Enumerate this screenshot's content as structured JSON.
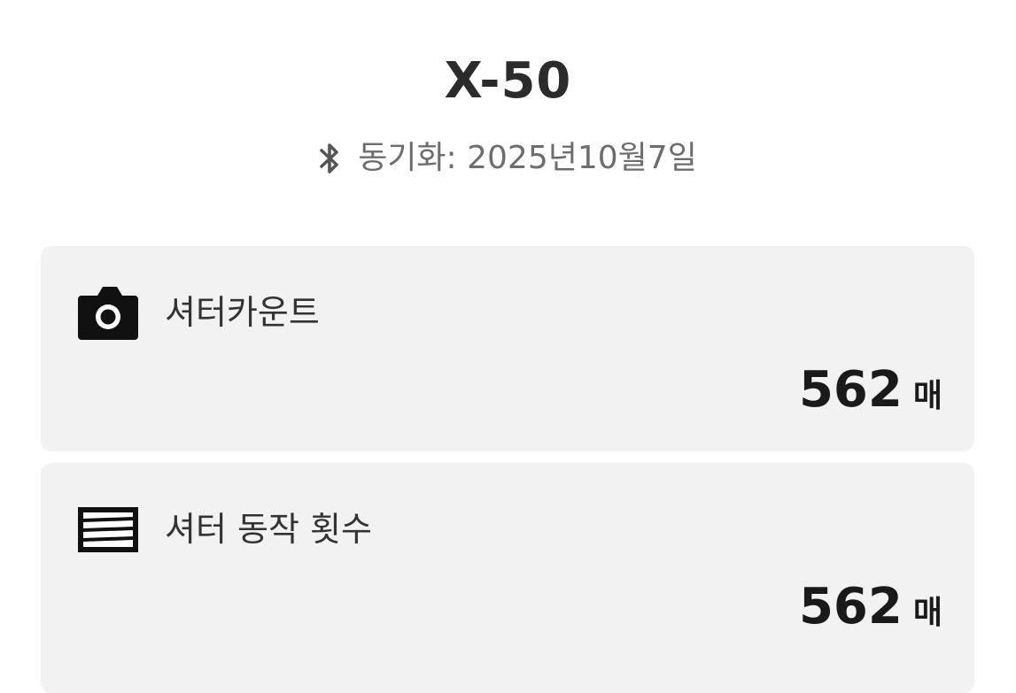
{
  "header": {
    "title": "X-50",
    "sync_icon": "bluetooth-icon",
    "sync_text": "동기화: 2025년10월7일"
  },
  "cards": [
    {
      "icon": "camera-icon",
      "label": "셔터카운트",
      "value": "562",
      "unit": "매"
    },
    {
      "icon": "shutter-icon",
      "label": "셔터 동작 횟수",
      "value": "562",
      "unit": "매"
    }
  ],
  "colors": {
    "background": "#ffffff",
    "card_background": "#f2f2f2",
    "title_text": "#2b2b2b",
    "secondary_text": "#6d6d6d",
    "value_text": "#1a1a1a"
  }
}
